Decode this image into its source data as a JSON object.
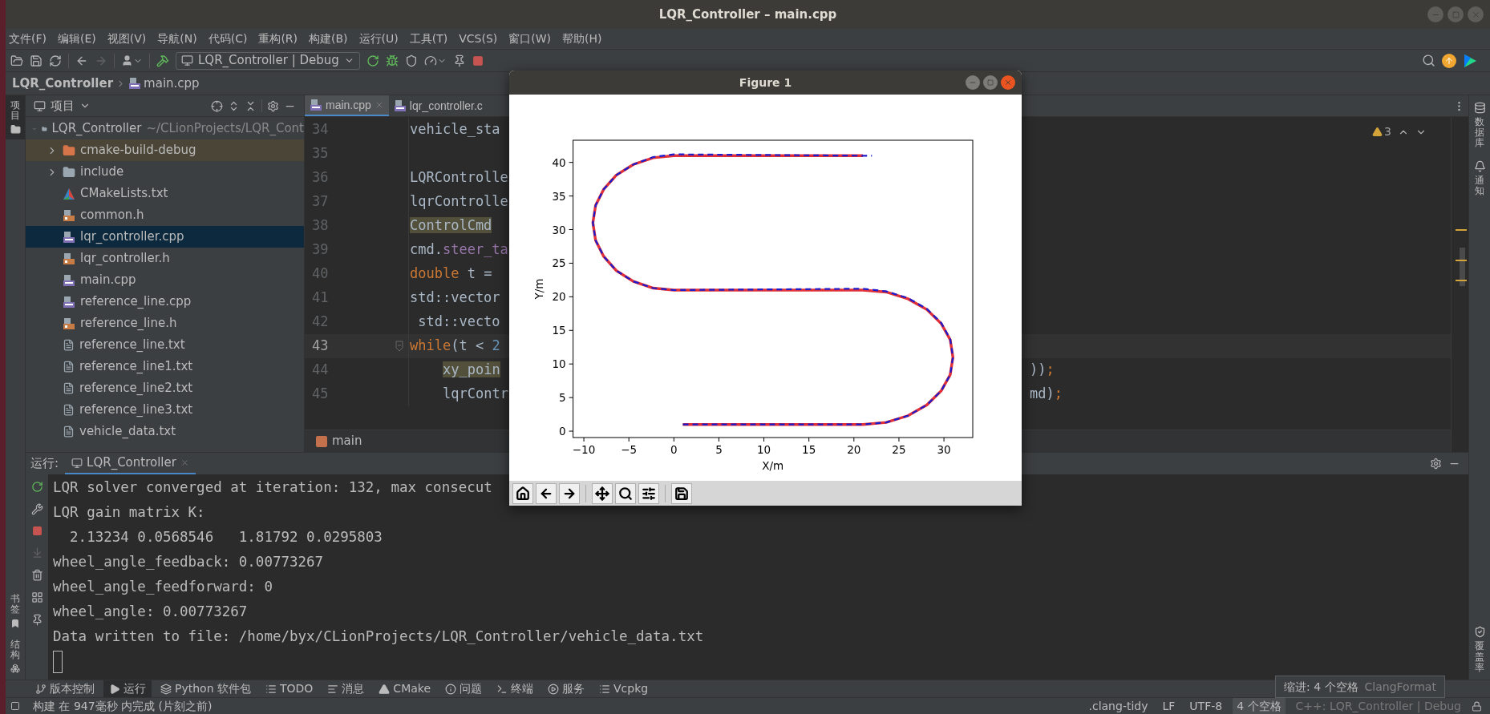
{
  "window": {
    "title": "LQR_Controller – main.cpp"
  },
  "menu": [
    "文件(F)",
    "编辑(E)",
    "视图(V)",
    "导航(N)",
    "代码(C)",
    "重构(R)",
    "构建(B)",
    "运行(U)",
    "工具(T)",
    "VCS(S)",
    "窗口(W)",
    "帮助(H)"
  ],
  "toolbar": {
    "navigation": [
      {
        "disabled": false
      },
      {
        "disabled": true
      }
    ],
    "run_config": "LQR_Controller | Debug"
  },
  "breadcrumb": {
    "project": "LQR_Controller",
    "file": "main.cpp"
  },
  "left_strip": {
    "top": [
      {
        "label": "项目",
        "selected": true
      }
    ],
    "bottom": [
      {
        "label": "书签",
        "kind": "bookmarks"
      },
      {
        "label": "结构",
        "kind": "structure"
      }
    ]
  },
  "project_panel": {
    "title": "项目",
    "tree": [
      {
        "name": "LQR_Controller",
        "path": "~/CLionProjects/LQR_Cont",
        "kind": "root",
        "expanded": true,
        "selected": false,
        "children": [
          {
            "name": "cmake-build-debug",
            "kind": "excluded_folder",
            "expanded": false,
            "selected": false
          },
          {
            "name": "include",
            "kind": "folder",
            "expanded": false,
            "selected": false
          },
          {
            "name": "CMakeLists.txt",
            "kind": "cmake",
            "selected": false
          },
          {
            "name": "common.h",
            "kind": "header",
            "selected": false
          },
          {
            "name": "lqr_controller.cpp",
            "kind": "source",
            "selected": true
          },
          {
            "name": "lqr_controller.h",
            "kind": "header",
            "selected": false
          },
          {
            "name": "main.cpp",
            "kind": "source",
            "selected": false
          },
          {
            "name": "reference_line.cpp",
            "kind": "source",
            "selected": false
          },
          {
            "name": "reference_line.h",
            "kind": "header",
            "selected": false
          },
          {
            "name": "reference_line.txt",
            "kind": "text",
            "selected": false
          },
          {
            "name": "reference_line1.txt",
            "kind": "text",
            "selected": false
          },
          {
            "name": "reference_line2.txt",
            "kind": "text",
            "selected": false
          },
          {
            "name": "reference_line3.txt",
            "kind": "text",
            "selected": false
          },
          {
            "name": "vehicle_data.txt",
            "kind": "text",
            "selected": false
          }
        ]
      }
    ]
  },
  "editor": {
    "tabs": [
      {
        "label": "main.cpp",
        "selected": true
      },
      {
        "label": "lqr_controller.c",
        "selected": false
      }
    ],
    "warnings": "3",
    "lines": [
      {
        "number": "34",
        "current": false,
        "nested": false,
        "tokens": [
          {
            "text": "vehicle_sta",
            "kind": "plain"
          }
        ]
      },
      {
        "number": "35",
        "current": false
      },
      {
        "number": "36",
        "current": false,
        "nested": false,
        "tokens": [
          {
            "text": "LQRControlle",
            "kind": "plain"
          }
        ]
      },
      {
        "number": "37",
        "current": false,
        "nested": false,
        "tokens": [
          {
            "text": "lqrControlle",
            "kind": "plain"
          }
        ]
      },
      {
        "number": "38",
        "current": false,
        "nested": false,
        "tokens": [
          {
            "text": "ControlCmd",
            "kind": "highlight"
          }
        ]
      },
      {
        "number": "39",
        "current": false,
        "nested": false,
        "tokens": [
          {
            "text": "cmd.",
            "kind": "plain"
          },
          {
            "text": "steer_ta",
            "kind": "field"
          }
        ]
      },
      {
        "number": "40",
        "current": false,
        "nested": false,
        "tokens": [
          {
            "text": "double",
            "kind": "keyword"
          },
          {
            "text": " t =",
            "kind": "plain"
          }
        ]
      },
      {
        "number": "41",
        "current": false,
        "nested": false,
        "tokens": [
          {
            "text": "std::vector",
            "kind": "plain"
          }
        ]
      },
      {
        "number": "42",
        "current": false,
        "nested": false,
        "tokens": [
          {
            "text": " std::vecto",
            "kind": "plain"
          }
        ]
      },
      {
        "number": "43",
        "current": true,
        "nested": false,
        "tokens": [
          {
            "text": "while",
            "kind": "keyword"
          },
          {
            "text": "(t < ",
            "kind": "plain"
          },
          {
            "text": "2",
            "kind": "number"
          }
        ]
      },
      {
        "number": "44",
        "current": false,
        "nested": true,
        "tokens": [
          {
            "text": "xy_poin",
            "kind": "highlight"
          }
        ],
        "tail": [
          {
            "text": "))",
            "kind": "plain"
          },
          {
            "text": ";",
            "kind": "keyword"
          }
        ]
      },
      {
        "number": "45",
        "current": false,
        "nested": true,
        "tokens": [
          {
            "text": "lqrContr",
            "kind": "plain"
          }
        ],
        "tail": [
          {
            "text": "md)",
            "kind": "plain"
          },
          {
            "text": ";",
            "kind": "keyword"
          }
        ]
      }
    ],
    "breadcrumb": "main"
  },
  "right_strip": [
    {
      "label": "数据库",
      "kind": "database"
    },
    {
      "label": "通知",
      "kind": "notifications"
    },
    {
      "label": "覆盖率",
      "kind": "coverage"
    }
  ],
  "run_panel": {
    "label": "运行:",
    "tab": "LQR_Controller",
    "output": [
      "LQR solver converged at iteration: 132, max consecut",
      "LQR gain matrix K:",
      "  2.13234 0.0568546   1.81792 0.0295803",
      "wheel_angle_feedback: 0.00773267",
      "wheel_angle_feedforward: 0",
      "wheel_angle: 0.00773267",
      "Data written to file: /home/byx/CLionProjects/LQR_Controller/vehicle_data.txt"
    ]
  },
  "tool_windows": [
    {
      "label": "版本控制",
      "kind": "vcs",
      "selected": false
    },
    {
      "label": "运行",
      "kind": "run",
      "selected": true
    },
    {
      "label": "Python 软件包",
      "kind": "python",
      "selected": false
    },
    {
      "label": "TODO",
      "kind": "todo",
      "selected": false
    },
    {
      "label": "消息",
      "kind": "messages",
      "selected": false
    },
    {
      "label": "CMake",
      "kind": "cmake",
      "selected": false
    },
    {
      "label": "问题",
      "kind": "problems",
      "selected": false
    },
    {
      "label": "终端",
      "kind": "terminal",
      "selected": false
    },
    {
      "label": "服务",
      "kind": "services",
      "selected": false
    },
    {
      "label": "Vcpkg",
      "kind": "vcpkg",
      "selected": false
    }
  ],
  "status_bar": {
    "message": "构建 在 947毫秒 内完成 (片刻之前)",
    "items": [
      {
        "label": ".clang-tidy",
        "selected": false,
        "disabled": false
      },
      {
        "label": "LF",
        "selected": false,
        "disabled": false
      },
      {
        "label": "UTF-8",
        "selected": false,
        "disabled": false
      },
      {
        "label": "4 个空格",
        "selected": true,
        "disabled": false
      },
      {
        "label": "C++: LQR_Controller | Debug",
        "selected": false,
        "disabled": true
      }
    ]
  },
  "tooltip": {
    "label": "缩进: 4 个空格",
    "hint": "ClangFormat"
  },
  "figure": {
    "title": "Figure 1",
    "chart_data": {
      "type": "line",
      "xlabel": "X/m",
      "ylabel": "Y/m",
      "xlim": [
        -11.2,
        33.2
      ],
      "ylim": [
        -0.95,
        43.3
      ],
      "xticks": [
        {
          "value": -10,
          "label": "−10"
        },
        {
          "value": -5,
          "label": "−5"
        },
        0,
        5,
        10,
        15,
        20,
        25,
        30
      ],
      "yticks": [
        0,
        5,
        10,
        15,
        20,
        25,
        30,
        35,
        40
      ],
      "x": [
        1,
        21,
        23.6,
        26,
        28.1,
        29.7,
        30.7,
        31,
        30.7,
        29.7,
        28.1,
        26,
        23.6,
        21,
        0,
        -2.3,
        -4.5,
        -6.4,
        -7.8,
        -8.7,
        -9,
        -8.7,
        -7.8,
        -6.4,
        -4.5,
        -2.3,
        0,
        21,
        22
      ],
      "series": [
        {
          "color": "#e0303a",
          "line_style": "solid",
          "values": [
            1,
            1,
            1.3,
            2.3,
            3.9,
            6,
            8.4,
            11,
            13.6,
            16,
            18.1,
            19.7,
            20.7,
            21,
            21,
            21.3,
            22.3,
            23.9,
            26,
            28.4,
            31,
            33.6,
            36,
            38.1,
            39.7,
            40.7,
            41,
            41,
            null
          ]
        },
        {
          "color": "#1c1ccc",
          "line_style": "dashed",
          "values": [
            1,
            1,
            1.3,
            2.3,
            3.9,
            6,
            8.4,
            11,
            13.7,
            16.1,
            18.2,
            19.8,
            20.8,
            21.2,
            21,
            21.3,
            22.3,
            23.9,
            26,
            28.4,
            31,
            33.6,
            36,
            38.1,
            39.7,
            40.8,
            41.2,
            41,
            41
          ]
        }
      ]
    }
  }
}
